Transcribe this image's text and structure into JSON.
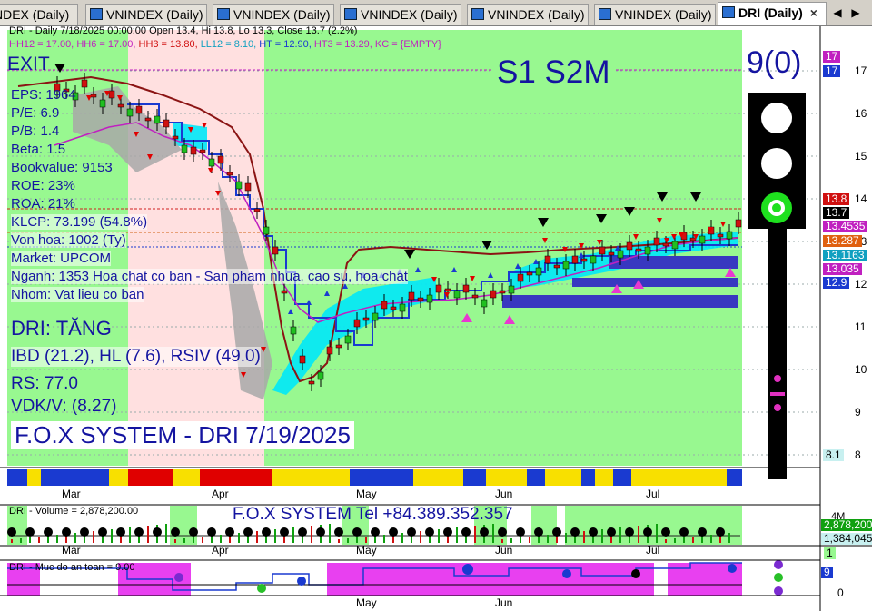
{
  "tabs": [
    {
      "label": "NDEX (Daily)",
      "active": false
    },
    {
      "label": "VNINDEX (Daily)",
      "active": false
    },
    {
      "label": "VNINDEX (Daily)",
      "active": false
    },
    {
      "label": "VNINDEX (Daily)",
      "active": false
    },
    {
      "label": "VNINDEX (Daily)",
      "active": false
    },
    {
      "label": "VNINDEX (Daily)",
      "active": false
    },
    {
      "label": "DRI (Daily)",
      "active": true
    }
  ],
  "header": {
    "title_line": "DRI - Daily 7/18/2025 00:00:00 Open 13.4, Hi 13.8, Lo 13.3, Close 13.7 (2.2%)",
    "indicators": {
      "hh12": "HH12 = 17.00,",
      "hh6": "HH6 = 17.00,",
      "hh3": "HH3 = 13.80,",
      "ll12": "LL12 = 8.10,",
      "ht": "HT = 12.90,",
      "ht3": "HT3 = 13.29,",
      "kc": "KC = {EMPTY}"
    }
  },
  "overlay": {
    "exit": "EXIT",
    "s1s2m": "S1  S2M",
    "signal_count": "9(0)",
    "info_lines": [
      "EPS: 1964",
      "P/E: 6.9",
      "P/B: 1.4",
      "Beta: 1.5",
      "Bookvalue: 9153",
      "ROE: 23%",
      "ROA: 21%",
      "KLCP: 73.199 (54.8%)",
      "Von hoa: 1002 (Ty)",
      "Market: UPCOM",
      "Nganh: 1353 Hoa chat co ban - San pham nhua, cao su, hoa chat",
      "Nhom: Vat lieu co ban"
    ],
    "status": "DRI: TĂNG",
    "ibd_line": "IBD (21.2), HL (7.6), RSIV (49.0)",
    "rs": "RS: 77.0",
    "vdk": "VDK/V:  (8.27)",
    "system": "F.O.X SYSTEM - DRI 7/19/2025"
  },
  "price_axis": {
    "ticks": [
      "17",
      "16",
      "15",
      "14",
      "13",
      "12",
      "11",
      "10",
      "9",
      "8"
    ],
    "boxes": [
      {
        "label": "17",
        "color": "#c020c0"
      },
      {
        "label": "17",
        "color": "#1a3ad0"
      },
      {
        "label": "13.8",
        "color": "#d01010"
      },
      {
        "label": "13.7",
        "color": "#000000"
      },
      {
        "label": "13.4535",
        "color": "#c020c0"
      },
      {
        "label": "13.287",
        "color": "#e06010"
      },
      {
        "label": "13.1163",
        "color": "#10a0c0"
      },
      {
        "label": "13.035",
        "color": "#c020c0"
      },
      {
        "label": "12.9",
        "color": "#1a3ad0"
      },
      {
        "label": "8.1",
        "color": "#c8f0f0"
      }
    ]
  },
  "months": [
    "Mar",
    "Apr",
    "May",
    "Jun",
    "Jul"
  ],
  "volume": {
    "label": "DRI - Volume = 2,878,200.00",
    "tel": "F.O.X SYSTEM Tel +84.389.352.357",
    "axis_top": "4M",
    "box_value": "2,878,200",
    "box_value2": "1,384,045",
    "box_small": "1"
  },
  "safety": {
    "label": "DRI - Muc do an toan = 9.00",
    "axis_zero": "0",
    "box_value": "9"
  },
  "colors": {
    "green_bg": "#98f890",
    "pink_bg": "#ffe0e0",
    "blue_text": "#1414a0",
    "magenta": "#c020c0",
    "cyan": "#00e8f8",
    "blue": "#1a3ad0"
  }
}
